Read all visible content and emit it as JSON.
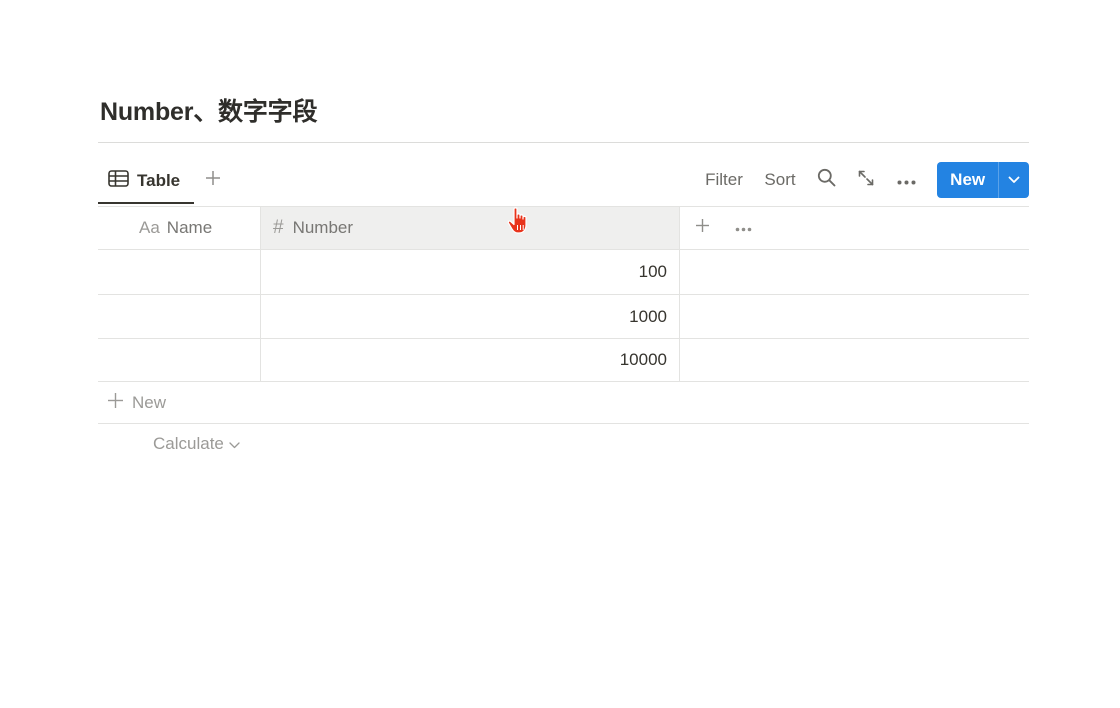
{
  "page": {
    "title": "Number、数字字段"
  },
  "view_bar": {
    "tab_label": "Table",
    "filter_label": "Filter",
    "sort_label": "Sort",
    "new_label": "New",
    "icons": {
      "table": "table-icon",
      "add_view": "plus-icon",
      "search": "search-icon",
      "expand": "expand-icon",
      "more": "more-horizontal-icon",
      "caret": "chevron-down-icon"
    }
  },
  "table": {
    "columns": [
      {
        "prefix": "Aa",
        "label": "Name"
      },
      {
        "prefix": "#",
        "label": "Number"
      }
    ],
    "rows": [
      {
        "name": "",
        "number": "100"
      },
      {
        "name": "",
        "number": "1000"
      },
      {
        "name": "",
        "number": "10000"
      }
    ],
    "add_row_label": "New",
    "calculate_label": "Calculate"
  },
  "colors": {
    "accent": "#2383e2",
    "text": "#37352f",
    "muted": "#787774",
    "border": "#e3e3e1",
    "header_hover": "#efefee",
    "cursor": "#e8341c"
  }
}
